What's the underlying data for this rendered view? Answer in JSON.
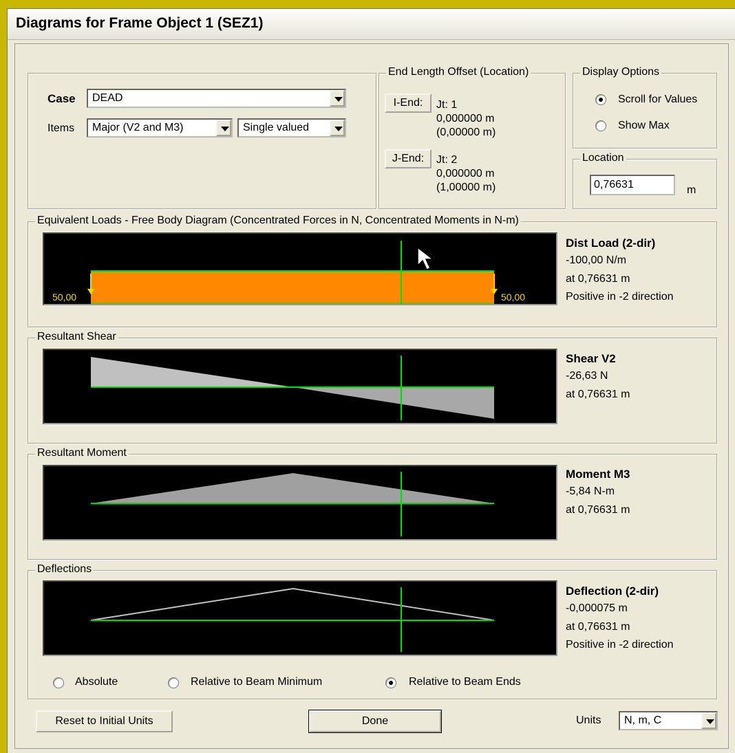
{
  "window": {
    "title": "Diagrams for Frame Object 1  (SEZ1)"
  },
  "case": {
    "label": "Case",
    "value": "DEAD"
  },
  "items": {
    "label": "Items",
    "major_value": "Major (V2 and M3)",
    "valued_value": "Single valued"
  },
  "end_length_offset": {
    "title": "End Length Offset (Location)",
    "i_end": {
      "button": "I-End:",
      "jt": "Jt:  1",
      "offset": "0,000000 m",
      "location": "(0,00000 m)"
    },
    "j_end": {
      "button": "J-End:",
      "jt": "Jt:  2",
      "offset": "0,000000 m",
      "location": "(1,00000 m)"
    }
  },
  "display_options": {
    "title": "Display Options",
    "scroll_for_values": "Scroll for Values",
    "show_max": "Show Max",
    "selected": "scroll_for_values"
  },
  "location": {
    "title": "Location",
    "value": "0,76631",
    "unit": "m"
  },
  "equivalent_loads": {
    "title": "Equivalent Loads - Free Body Diagram  (Concentrated Forces in N, Concentrated Moments in N-m)",
    "left_force": "50,00",
    "right_force": "50,00",
    "info_title": "Dist Load (2-dir)",
    "info_value": "-100,00 N/m",
    "info_at": "at 0,76631 m",
    "info_note": "Positive in -2 direction"
  },
  "resultant_shear": {
    "title": "Resultant Shear",
    "info_title": "Shear V2",
    "info_value": "-26,63 N",
    "info_at": "at 0,76631 m"
  },
  "resultant_moment": {
    "title": "Resultant Moment",
    "info_title": "Moment M3",
    "info_value": "-5,84 N-m",
    "info_at": "at 0,76631 m"
  },
  "deflections": {
    "title": "Deflections",
    "info_title": "Deflection (2-dir)",
    "info_value": "-0,000075 m",
    "info_at": "at 0,76631 m",
    "info_note": "Positive in -2 direction",
    "options": {
      "absolute": "Absolute",
      "relative_min": "Relative to Beam Minimum",
      "relative_ends": "Relative to Beam Ends"
    },
    "selected": "relative_ends"
  },
  "footer": {
    "reset_button": "Reset to Initial Units",
    "done_button": "Done",
    "units_label": "Units",
    "units_value": "N, m, C"
  },
  "colors": {
    "plot_bg": "#000000",
    "axis": "#00dd00",
    "load_fill": "#ff8800",
    "shear_fill": "#c0c0c0",
    "moment_fill": "#a0a0a0",
    "deflection_line": "#c0c0c0",
    "force_label": "#f0d800"
  },
  "icons": {
    "cursor": "mouse-pointer-icon",
    "dropdown": "chevron-down-icon"
  }
}
